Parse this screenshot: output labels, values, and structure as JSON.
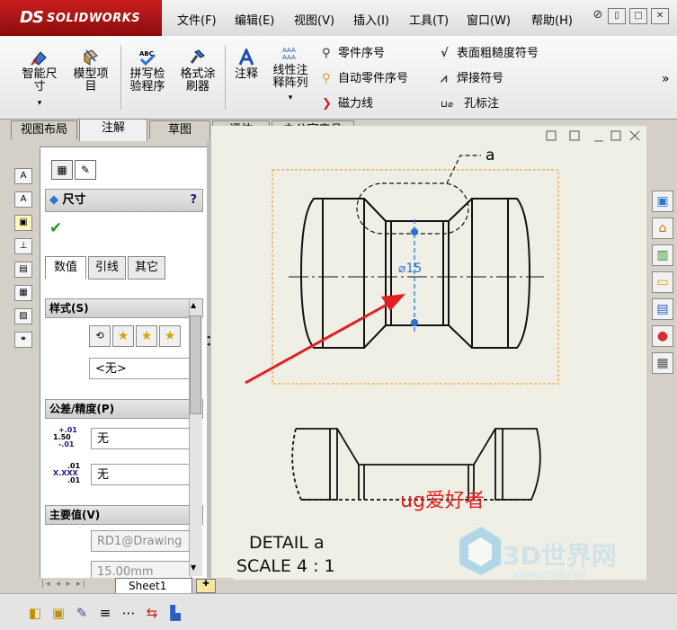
{
  "app": {
    "logo_ds": "DS",
    "logo_text": "SOLIDWORKS"
  },
  "menu": [
    "文件(F)",
    "编辑(E)",
    "视图(V)",
    "插入(I)",
    "工具(T)",
    "窗口(W)",
    "帮助(H)"
  ],
  "window_controls": {
    "pin": "⊘",
    "restore": "▯",
    "maximize": "□",
    "close": "✕"
  },
  "ribbon": {
    "smart_dim": "智能尺\n寸",
    "model_items": "模型项\n目",
    "spell_check": "拼写检\n验程序",
    "format_painter": "格式涂\n刷器",
    "note": "注释",
    "linear_note_pattern": "线性注\n释阵列",
    "balloon": "零件序号",
    "auto_balloon": "自动零件序号",
    "magnetic_line": "磁力线",
    "surface_finish": "表面粗糙度符号",
    "weld_symbol": "焊接符号",
    "hole_callout": "孔标注",
    "hole_glyph": "⊔⌀",
    "more": "»",
    "abc": "ABC",
    "aaa": "AAA"
  },
  "tabs": [
    "视图布局",
    "注解",
    "草图",
    "评估",
    "办公室产品"
  ],
  "active_tab": 1,
  "pm": {
    "title": "尺寸",
    "help": "?",
    "ok": "✔",
    "subtabs": [
      "数值",
      "引线",
      "其它"
    ],
    "style_header": "样式(S)",
    "style_value": "<无>",
    "tolerance_header": "公差/精度(P)",
    "tol_value": "无",
    "prec_value": "无",
    "tol_icon_top": "+.01",
    "tol_icon_mid": "1.50",
    "tol_icon_bot": "-.01",
    "prec_icon_top": ".01",
    "prec_icon_mid": "X.XXX",
    "prec_icon_bot": ".01",
    "primary_header": "主要值(V)",
    "primary_name": "RD1@Drawing",
    "primary_value": "15.00mm"
  },
  "sheet_tab": "Sheet1",
  "drawing": {
    "callout": "a",
    "dimension": "⌀15",
    "watermark_text": "ug爱好者",
    "detail_line1": "DETAIL a",
    "detail_line2": "SCALE 4 : 1",
    "site_logo": "3D世界网",
    "site_url": "WWW.3DSJW.COM"
  },
  "colors": {
    "accent_blue": "#2a74d6",
    "arrow_red": "#e02020",
    "frame_orange": "#f0a040",
    "logo_red": "#b31818"
  }
}
